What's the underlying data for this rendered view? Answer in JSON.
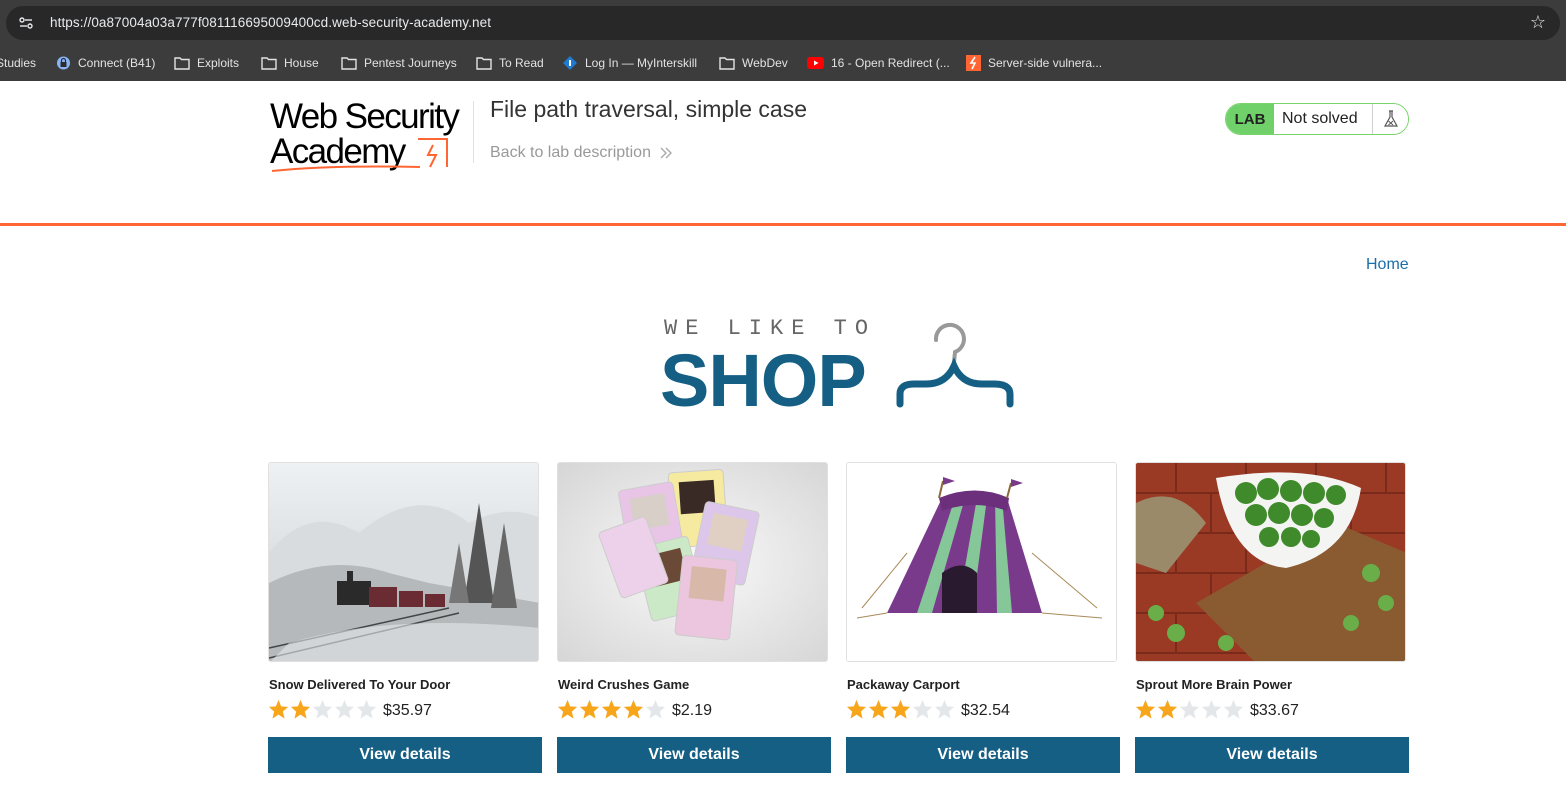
{
  "browser": {
    "url": "https://0a87004a03a777f081116695009400cd.web-security-academy.net",
    "bookmarks": [
      {
        "label": "Studies",
        "icon": "folder-icon"
      },
      {
        "label": "Connect (B41)",
        "icon": "lock-globe-icon"
      },
      {
        "label": "Exploits",
        "icon": "folder-icon"
      },
      {
        "label": "House",
        "icon": "folder-icon"
      },
      {
        "label": "Pentest Journeys",
        "icon": "folder-icon"
      },
      {
        "label": "To Read",
        "icon": "folder-icon"
      },
      {
        "label": "Log In — MyInterskill",
        "icon": "diamond-icon"
      },
      {
        "label": "WebDev",
        "icon": "folder-icon"
      },
      {
        "label": "16 - Open Redirect (...",
        "icon": "youtube-icon"
      },
      {
        "label": "Server-side vulnera...",
        "icon": "portswigger-icon"
      }
    ]
  },
  "lab": {
    "logo_line1": "Web Security",
    "logo_line2": "Academy",
    "title": "File path traversal, simple case",
    "back_link": "Back to lab description",
    "badge": "LAB",
    "status": "Not solved"
  },
  "shop": {
    "home_link": "Home",
    "logo_top": "WE LIKE TO",
    "logo_main": "SHOP",
    "products": [
      {
        "name": "Snow Delivered To Your Door",
        "rating": 2,
        "price": "$35.97",
        "button": "View details",
        "image": "snowy-train"
      },
      {
        "name": "Weird Crushes Game",
        "rating": 4,
        "price": "$2.19",
        "button": "View details",
        "image": "cards"
      },
      {
        "name": "Packaway Carport",
        "rating": 3,
        "price": "$32.54",
        "button": "View details",
        "image": "tent"
      },
      {
        "name": "Sprout More Brain Power",
        "rating": 2,
        "price": "$33.67",
        "button": "View details",
        "image": "sprouts"
      }
    ]
  },
  "colors": {
    "accent": "#ff6633",
    "primary": "#155f85",
    "star_on": "#f7a61b",
    "star_off": "#e4e7ea",
    "lab_green": "#70d16a"
  }
}
